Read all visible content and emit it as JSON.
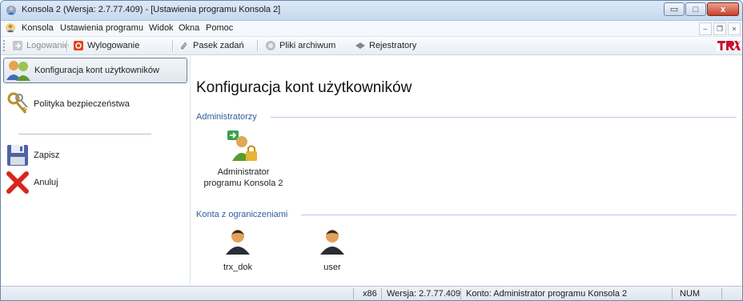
{
  "window": {
    "title": "Konsola 2 (Wersja:  2.7.77.409) - [Ustawienia programu Konsola 2]",
    "controls": {
      "minimize": "▭",
      "maximize": "□",
      "close": "x"
    }
  },
  "menubar": {
    "items": [
      "Konsola",
      "Ustawienia programu",
      "Widok",
      "Okna",
      "Pomoc"
    ],
    "mdi_controls": {
      "minimize": "–",
      "restore": "❐",
      "close": "×"
    }
  },
  "toolbar": {
    "login": "Logowanie",
    "logout": "Wylogowanie",
    "taskbar": "Pasek zadań",
    "archive": "Pliki archiwum",
    "recorders": "Rejestratory",
    "logo_text": "TRX"
  },
  "sidebar": {
    "items": [
      {
        "label": "Konfiguracja kont użytkowników",
        "icon": "users-config-icon",
        "active": true
      },
      {
        "label": "Polityka bezpieczeństwa",
        "icon": "keys-icon",
        "active": false
      },
      {
        "label": "Zapisz",
        "icon": "floppy-save-icon",
        "active": false
      },
      {
        "label": "Anuluj",
        "icon": "red-x-icon",
        "active": false
      }
    ]
  },
  "main": {
    "title": "Konfiguracja kont użytkowników",
    "groups": [
      {
        "title": "Administratorzy",
        "accounts": [
          {
            "label_line1": "Administrator",
            "label_line2": "programu Konsola 2",
            "icon": "admin-user-lock-icon"
          }
        ]
      },
      {
        "title": "Konta z ograniczeniami",
        "accounts": [
          {
            "label_line1": "trx_dok",
            "label_line2": "",
            "icon": "user-icon"
          },
          {
            "label_line1": "user",
            "label_line2": "",
            "icon": "user-icon"
          }
        ]
      }
    ]
  },
  "statusbar": {
    "arch": "x86",
    "version": "Wersja: 2.7.77.409",
    "account": "Konto: Administrator programu Konsola 2",
    "num": "NUM"
  },
  "colors": {
    "group_title": "#2f5e9a",
    "close_button": "#c5432a",
    "logout_icon": "#e2451c"
  }
}
